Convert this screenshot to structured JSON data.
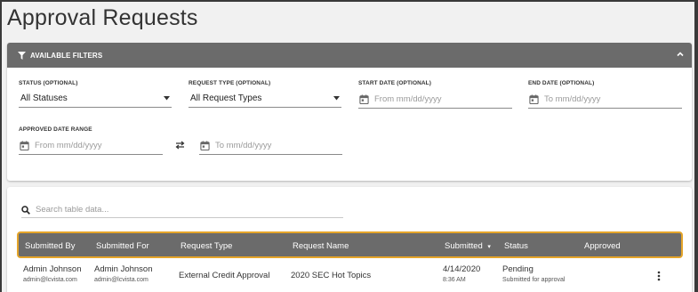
{
  "page": {
    "title": "Approval Requests"
  },
  "filters": {
    "header": "AVAILABLE FILTERS",
    "status": {
      "label": "STATUS (OPTIONAL)",
      "value": "All Statuses"
    },
    "request_type": {
      "label": "REQUEST TYPE (OPTIONAL)",
      "value": "All Request Types"
    },
    "start_date": {
      "label": "START DATE (OPTIONAL)",
      "placeholder": "From mm/dd/yyyy"
    },
    "end_date": {
      "label": "END DATE (OPTIONAL)",
      "placeholder": "To mm/dd/yyyy"
    },
    "approved_range": {
      "label": "APPROVED DATE RANGE",
      "from_placeholder": "From mm/dd/yyyy",
      "to_placeholder": "To mm/dd/yyyy"
    }
  },
  "table": {
    "search_placeholder": "Search table data...",
    "columns": [
      "Submitted By",
      "Submitted For",
      "Request Type",
      "Request Name",
      "Submitted",
      "Status",
      "Approved"
    ],
    "sort_indicator": "▾",
    "rows": [
      {
        "submitted_by": "Admin Johnson",
        "submitted_by_email": "admin@lcvista.com",
        "submitted_for": "Admin Johnson",
        "submitted_for_email": "admin@lcvista.com",
        "request_type": "External Credit Approval",
        "request_name": "2020 SEC Hot Topics",
        "submitted_date": "4/14/2020",
        "submitted_time": "8:36 AM",
        "status": "Pending",
        "status_detail": "Submitted for approval",
        "approved": ""
      }
    ]
  },
  "colors": {
    "header_bg": "#6b6b6b",
    "highlight": "#e5a52a"
  }
}
